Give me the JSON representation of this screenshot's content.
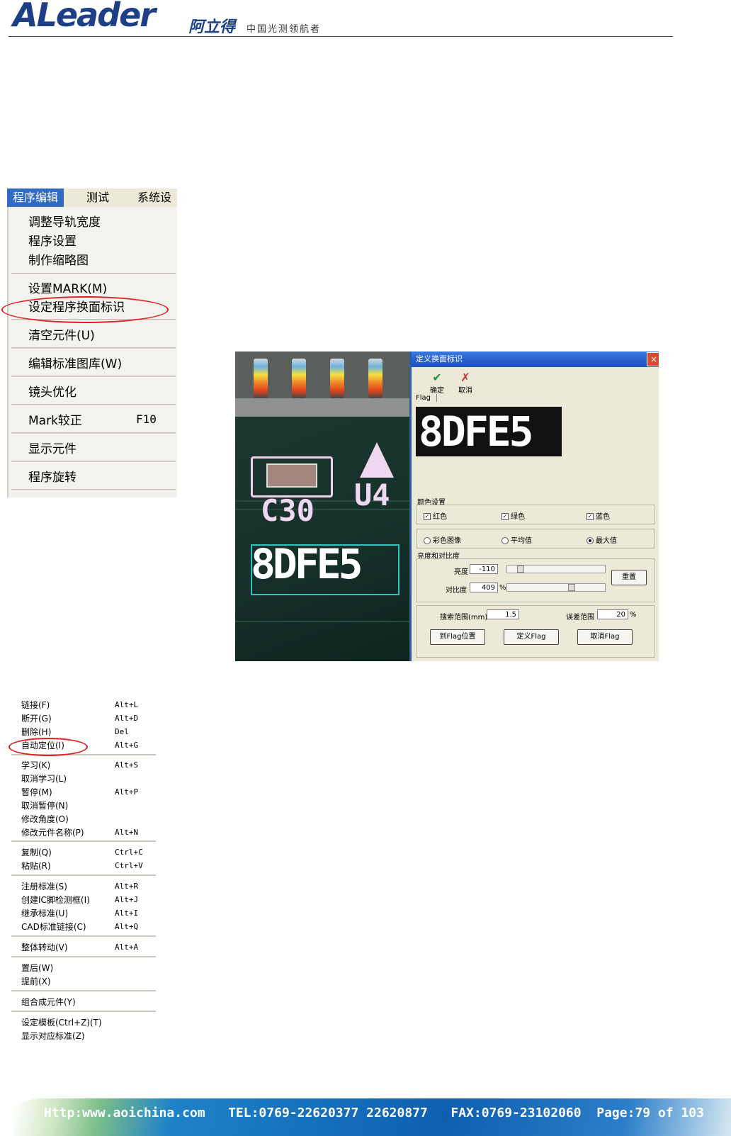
{
  "header": {
    "logo_text": "ALeader",
    "logo_cn": "阿立得",
    "slogan": "中国光测领航者"
  },
  "menu1": {
    "bar": [
      "程序编辑",
      "测试",
      "系统设"
    ],
    "items": [
      "调整导轨宽度",
      "程序设置",
      "制作缩略图",
      "设置MARK(M)",
      "设定程序换面标识",
      "清空元件(U)",
      "编辑标准图库(W)",
      "镜头优化",
      "Mark较正",
      "显示元件",
      "程序旋转"
    ],
    "mark_shortcut": "F10"
  },
  "figure": {
    "pcb_labels": [
      "C30",
      "U4",
      "8DFE5"
    ],
    "dialog": {
      "title": "定义换面标识",
      "close": "×",
      "ok": "确定",
      "cancel": "取消",
      "flag_tab": "Flag",
      "flag_text": "8DFE5",
      "color_group": "颜色设置",
      "red": "红色",
      "green": "绿色",
      "blue": "蓝色",
      "color_image": "彩色图像",
      "average": "平均值",
      "max": "最大值",
      "brightness_group": "亮度和对比度",
      "brightness_label": "亮度",
      "brightness_value": "-110",
      "contrast_label": "对比度",
      "contrast_value": "409",
      "contrast_unit": "%",
      "reset": "重置",
      "search_label": "搜索范围(mm)",
      "search_value": "1.5",
      "error_label": "误差范围",
      "error_value": "20",
      "error_unit": "%",
      "btn_goto": "到Flag位置",
      "btn_define": "定义Flag",
      "btn_cancel_flag": "取消Flag"
    }
  },
  "menu2": {
    "items": [
      {
        "label": "链接(F)",
        "shortcut": "Alt+L"
      },
      {
        "label": "断开(G)",
        "shortcut": "Alt+D"
      },
      {
        "label": "删除(H)",
        "shortcut": "Del"
      },
      {
        "label": "自动定位(I)",
        "shortcut": "Alt+G"
      },
      {
        "label": "学习(K)",
        "shortcut": "Alt+S"
      },
      {
        "label": "取消学习(L)",
        "shortcut": ""
      },
      {
        "label": "暂停(M)",
        "shortcut": "Alt+P"
      },
      {
        "label": "取消暂停(N)",
        "shortcut": ""
      },
      {
        "label": "修改角度(O)",
        "shortcut": ""
      },
      {
        "label": "修改元件名称(P)",
        "shortcut": "Alt+N"
      },
      {
        "label": "复制(Q)",
        "shortcut": "Ctrl+C"
      },
      {
        "label": "粘贴(R)",
        "shortcut": "Ctrl+V"
      },
      {
        "label": "注册标准(S)",
        "shortcut": "Alt+R"
      },
      {
        "label": "创建IC脚检测框(I)",
        "shortcut": "Alt+J"
      },
      {
        "label": "继承标准(U)",
        "shortcut": "Alt+I"
      },
      {
        "label": "CAD标准链接(C)",
        "shortcut": "Alt+Q"
      },
      {
        "label": "整体转动(V)",
        "shortcut": "Alt+A"
      },
      {
        "label": "置后(W)",
        "shortcut": ""
      },
      {
        "label": "提前(X)",
        "shortcut": ""
      },
      {
        "label": "组合成元件(Y)",
        "shortcut": ""
      },
      {
        "label": "设定模板(Ctrl+Z)(T)",
        "shortcut": ""
      },
      {
        "label": "显示对应标准(Z)",
        "shortcut": ""
      }
    ]
  },
  "footer": {
    "text": "Http:www.aoichina.com   TEL:0769-22620377 22620877   FAX:0769-23102060  Page:79 of 103"
  },
  "colors": {
    "brand_blue": "#1c3f86",
    "menu_highlight": "#316ac5",
    "annotation_red": "#e02020"
  }
}
